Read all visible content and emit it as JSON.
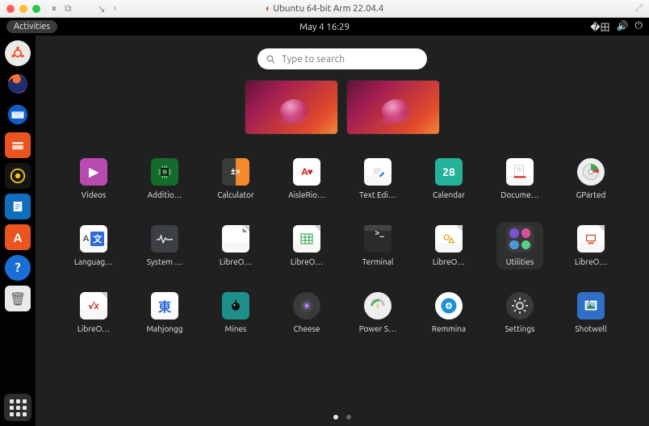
{
  "host": {
    "title": "Ubuntu 64-bit Arm 22.04.4"
  },
  "panel": {
    "activities": "Activities",
    "datetime": "May 4  16:29"
  },
  "search": {
    "placeholder": "Type to search"
  },
  "dock": [
    {
      "name": "accessibility",
      "bg": "#eaeaea",
      "fg": "#e95420",
      "glyph": "◎"
    },
    {
      "name": "firefox",
      "bg": "transparent"
    },
    {
      "name": "thunderbird",
      "bg": "transparent"
    },
    {
      "name": "files",
      "bg": "#e95420",
      "fg": "#fff",
      "glyph": "▭"
    },
    {
      "name": "rhythmbox",
      "bg": "#1a1a1a",
      "fg": "#f6c700",
      "glyph": "◉"
    },
    {
      "name": "libreoffice-writer",
      "bg": "#106ebe",
      "fg": "#fff",
      "glyph": "▤"
    },
    {
      "name": "software",
      "bg": "#e95420",
      "fg": "#fff",
      "glyph": "A"
    },
    {
      "name": "help",
      "bg": "#1a6fd6",
      "fg": "#fff",
      "glyph": "?"
    },
    {
      "name": "trash",
      "bg": "#eaeaea",
      "fg": "#5a5a5a",
      "glyph": "♻"
    }
  ],
  "apps": [
    [
      {
        "label": "Videos",
        "icon": "videos"
      },
      {
        "label": "Additio…",
        "icon": "drivers"
      },
      {
        "label": "Calculator",
        "icon": "calculator"
      },
      {
        "label": "AisleRio…",
        "icon": "aisleriot"
      },
      {
        "label": "Text Edi…",
        "icon": "gedit"
      },
      {
        "label": "Calendar",
        "icon": "calendar",
        "badge": "28"
      },
      {
        "label": "Docume…",
        "icon": "scanner"
      },
      {
        "label": "GParted",
        "icon": "gparted"
      }
    ],
    [
      {
        "label": "Languag…",
        "icon": "language"
      },
      {
        "label": "System …",
        "icon": "sysmon"
      },
      {
        "label": "LibreO…",
        "icon": "lo-start"
      },
      {
        "label": "LibreO…",
        "icon": "lo-calc"
      },
      {
        "label": "Terminal",
        "icon": "terminal"
      },
      {
        "label": "LibreO…",
        "icon": "lo-draw"
      },
      {
        "label": "Utilities",
        "icon": "group",
        "selected": true
      },
      {
        "label": "LibreO…",
        "icon": "lo-impress"
      }
    ],
    [
      {
        "label": "LibreO…",
        "icon": "lo-math"
      },
      {
        "label": "Mahjongg",
        "icon": "mahjongg"
      },
      {
        "label": "Mines",
        "icon": "mines"
      },
      {
        "label": "Cheese",
        "icon": "cheese"
      },
      {
        "label": "Power S…",
        "icon": "powerstats"
      },
      {
        "label": "Remmina",
        "icon": "remmina"
      },
      {
        "label": "Settings",
        "icon": "settings"
      },
      {
        "label": "Shotwell",
        "icon": "shotwell"
      }
    ]
  ],
  "pager": {
    "pages": 2,
    "current": 0
  }
}
